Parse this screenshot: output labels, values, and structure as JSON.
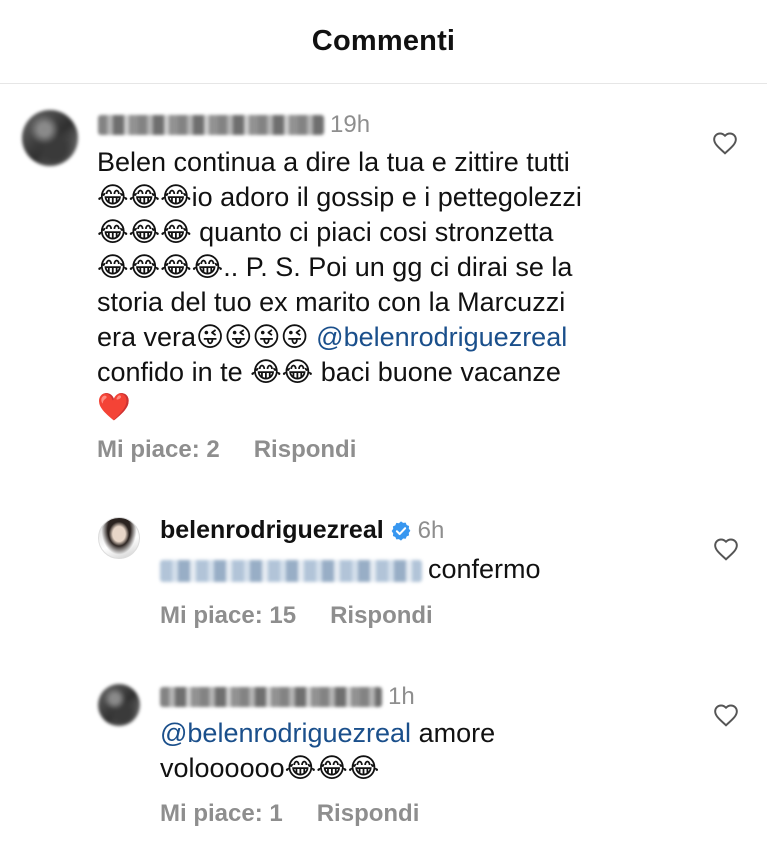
{
  "header": {
    "title": "Commenti"
  },
  "comments": [
    {
      "username_redacted": true,
      "time": "19h",
      "lines": [
        "Belen continua a dire la tua e zittire tutti",
        "😂😂😂io adoro il gossip e i pettegolezzi",
        "😂😂😂 quanto ci piaci cosi stronzetta",
        "😂😂😂😂.. P. S. Poi un gg ci dirai se la",
        "storia del tuo ex marito con la Marcuzzi",
        "era vera😜😜😜😜",
        "confido in te 😂😂 baci buone vacanze",
        "❤️"
      ],
      "mention": "@belenrodriguezreal",
      "likes_label": "Mi piace: 2",
      "reply_label": "Rispondi",
      "icon": "heart-outline-icon"
    },
    {
      "username": "belenrodriguezreal",
      "verified": true,
      "time": "6h",
      "text": "confermo",
      "likes_label": "Mi piace: 15",
      "reply_label": "Rispondi",
      "icon": "heart-outline-icon"
    },
    {
      "username_redacted": true,
      "time": "1h",
      "mention": "@belenrodriguezreal",
      "text_after_mention": " amore",
      "line2": "voloooooo😂😂😂",
      "likes_label": "Mi piace: 1",
      "reply_label": "Rispondi",
      "icon": "heart-outline-icon"
    }
  ],
  "colors": {
    "mention": "#1a4f8b",
    "muted": "#8e8e8e",
    "verified": "#3897f0"
  }
}
